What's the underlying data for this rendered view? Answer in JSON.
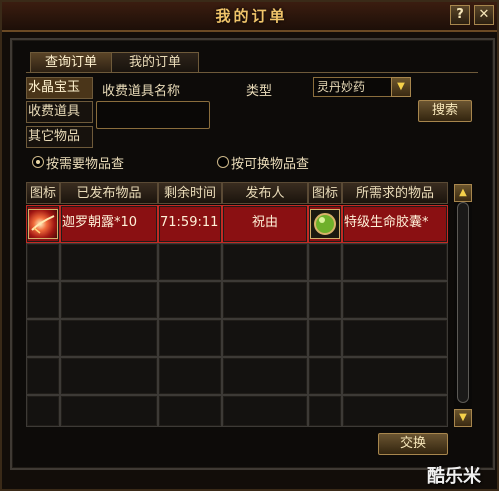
{
  "window": {
    "title": "我的订单",
    "help_label": "?",
    "close_label": "✕"
  },
  "tabs": [
    {
      "label": "查询订单",
      "active": true
    },
    {
      "label": "我的订单",
      "active": false
    }
  ],
  "categories": [
    {
      "label": "水晶宝玉",
      "selected": true
    },
    {
      "label": "收费道具",
      "selected": false
    },
    {
      "label": "其它物品",
      "selected": false
    }
  ],
  "filters": {
    "item_name_label": "收费道具名称",
    "item_name_value": "",
    "type_label": "类型",
    "type_value": "灵丹妙药",
    "search_button": "搜索"
  },
  "search_mode": [
    {
      "label": "按需要物品查",
      "checked": true
    },
    {
      "label": "按可换物品查",
      "checked": false
    }
  ],
  "table": {
    "columns": [
      "图标",
      "已发布物品",
      "剩余时间",
      "发布人",
      "图标",
      "所需求的物品"
    ],
    "rows": [
      {
        "icon": "red-feather-item-icon",
        "item": "迦罗朝露*10",
        "time_left": "71:59:11",
        "publisher": "祝由",
        "req_icon": "green-orb-item-icon",
        "required_item": "特级生命胶囊*"
      }
    ]
  },
  "exchange_button": "交换",
  "watermark": "酷乐米"
}
